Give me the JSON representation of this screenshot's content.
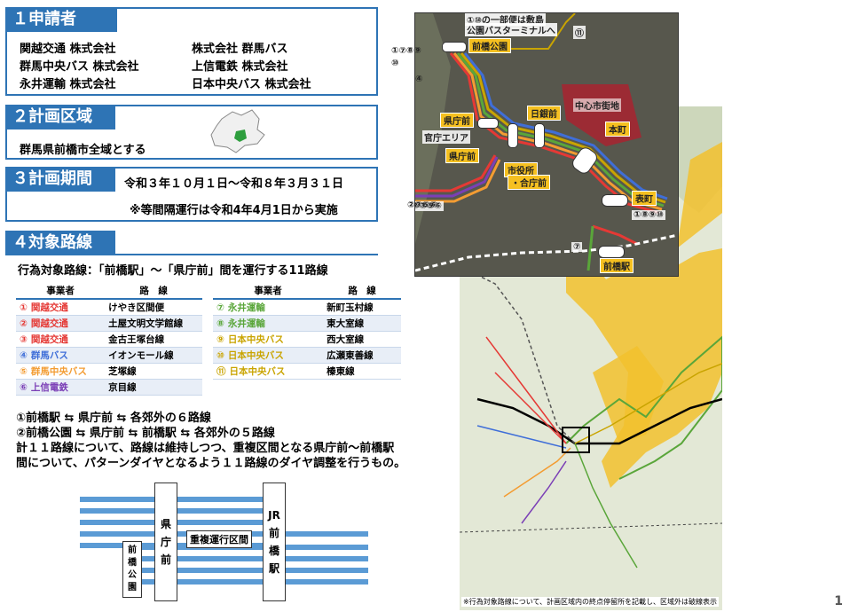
{
  "sec1": {
    "title": "１申請者",
    "applicants": [
      "関越交通 株式会社",
      "株式会社 群馬バス",
      "群馬中央バス 株式会社",
      "上信電鉄 株式会社",
      "永井運輸 株式会社",
      "日本中央バス 株式会社"
    ]
  },
  "sec2": {
    "title": "２計画区域",
    "text": "群馬県前橋市全域とする"
  },
  "sec3": {
    "title": "３計画期間",
    "period": "令和３年１０月１日～令和８年３月３１日",
    "note": "※等間隔運行は令和4年4月1日から実施"
  },
  "sec4": {
    "title": "４対象路線",
    "subtitle": "行為対象路線：「前橋駅」～「県庁前」間を運行する11路線",
    "col_operator": "事業者",
    "col_route": "路　線",
    "left_routes": [
      {
        "num": "①",
        "operator": "関越交通",
        "route": "けやき区間便",
        "color": "#e53935"
      },
      {
        "num": "②",
        "operator": "関越交通",
        "route": "土屋文明文学館線",
        "color": "#e53935"
      },
      {
        "num": "③",
        "operator": "関越交通",
        "route": "金古王塚台線",
        "color": "#e53935"
      },
      {
        "num": "④",
        "operator": "群馬バス",
        "route": "イオンモール線",
        "color": "#3f6ed8"
      },
      {
        "num": "⑤",
        "operator": "群馬中央バス",
        "route": "芝塚線",
        "color": "#f39c32"
      },
      {
        "num": "⑥",
        "operator": "上信電鉄",
        "route": "京目線",
        "color": "#7b3fb6"
      }
    ],
    "right_routes": [
      {
        "num": "⑦",
        "operator": "永井運輸",
        "route": "新町玉村線",
        "color": "#5aa63a"
      },
      {
        "num": "⑧",
        "operator": "永井運輸",
        "route": "東大室線",
        "color": "#5aa63a"
      },
      {
        "num": "⑨",
        "operator": "日本中央バス",
        "route": "西大室線",
        "color": "#c9a400"
      },
      {
        "num": "⑩",
        "operator": "日本中央バス",
        "route": "広瀬東善線",
        "color": "#c9a400"
      },
      {
        "num": "⑪",
        "operator": "日本中央バス",
        "route": "榛東線",
        "color": "#c9a400"
      }
    ],
    "desc1": "①前橋駅 ⇆ 県庁前 ⇆ 各郊外の６路線",
    "desc2": "②前橋公園 ⇆ 県庁前 ⇆ 前橋駅 ⇆ 各郊外の５路線",
    "desc3": "計１１路線について、路線は維持しつつ、重複区間となる県庁前～前橋駅",
    "desc4": "間について、パターンダイヤとなるよう１１路線のダイヤ調整を行うもの。"
  },
  "diagram": {
    "kenchomae": [
      "県",
      "庁",
      "前"
    ],
    "maebashi_sta": [
      "JR",
      "前",
      "橋",
      "駅"
    ],
    "park": [
      "前",
      "橋",
      "公",
      "園"
    ],
    "overlap": "重複運行区間"
  },
  "zoom": {
    "top_note1": "①⑩の一部便は敷島",
    "top_note2": "公園バスターミナルへ",
    "maebashi_park": "前橋公園",
    "kenchomae1": "県庁前",
    "kenchomae2": "県庁前",
    "kancho_area": "官庁エリア",
    "nichigin": "日銀前",
    "chushin": "中心市街地",
    "honmachi": "本町",
    "shiyakusho1": "市役所",
    "shiyakusho2": "・合庁前",
    "omotecho": "表町",
    "maebashi_eki": "前橋駅",
    "nums_left_top": "①⑦⑧⑨",
    "num_10": "⑩",
    "num_4": "④",
    "nums_left_bottom": "②③⑤⑥",
    "nums_right": "①⑧⑨⑩",
    "num_7": "⑦",
    "num_11": "⑪"
  },
  "map": {
    "footnote": "※行為対象路線について、計画区域内の終点停留所を記載し、区域外は破線表示"
  },
  "page_number": "1"
}
